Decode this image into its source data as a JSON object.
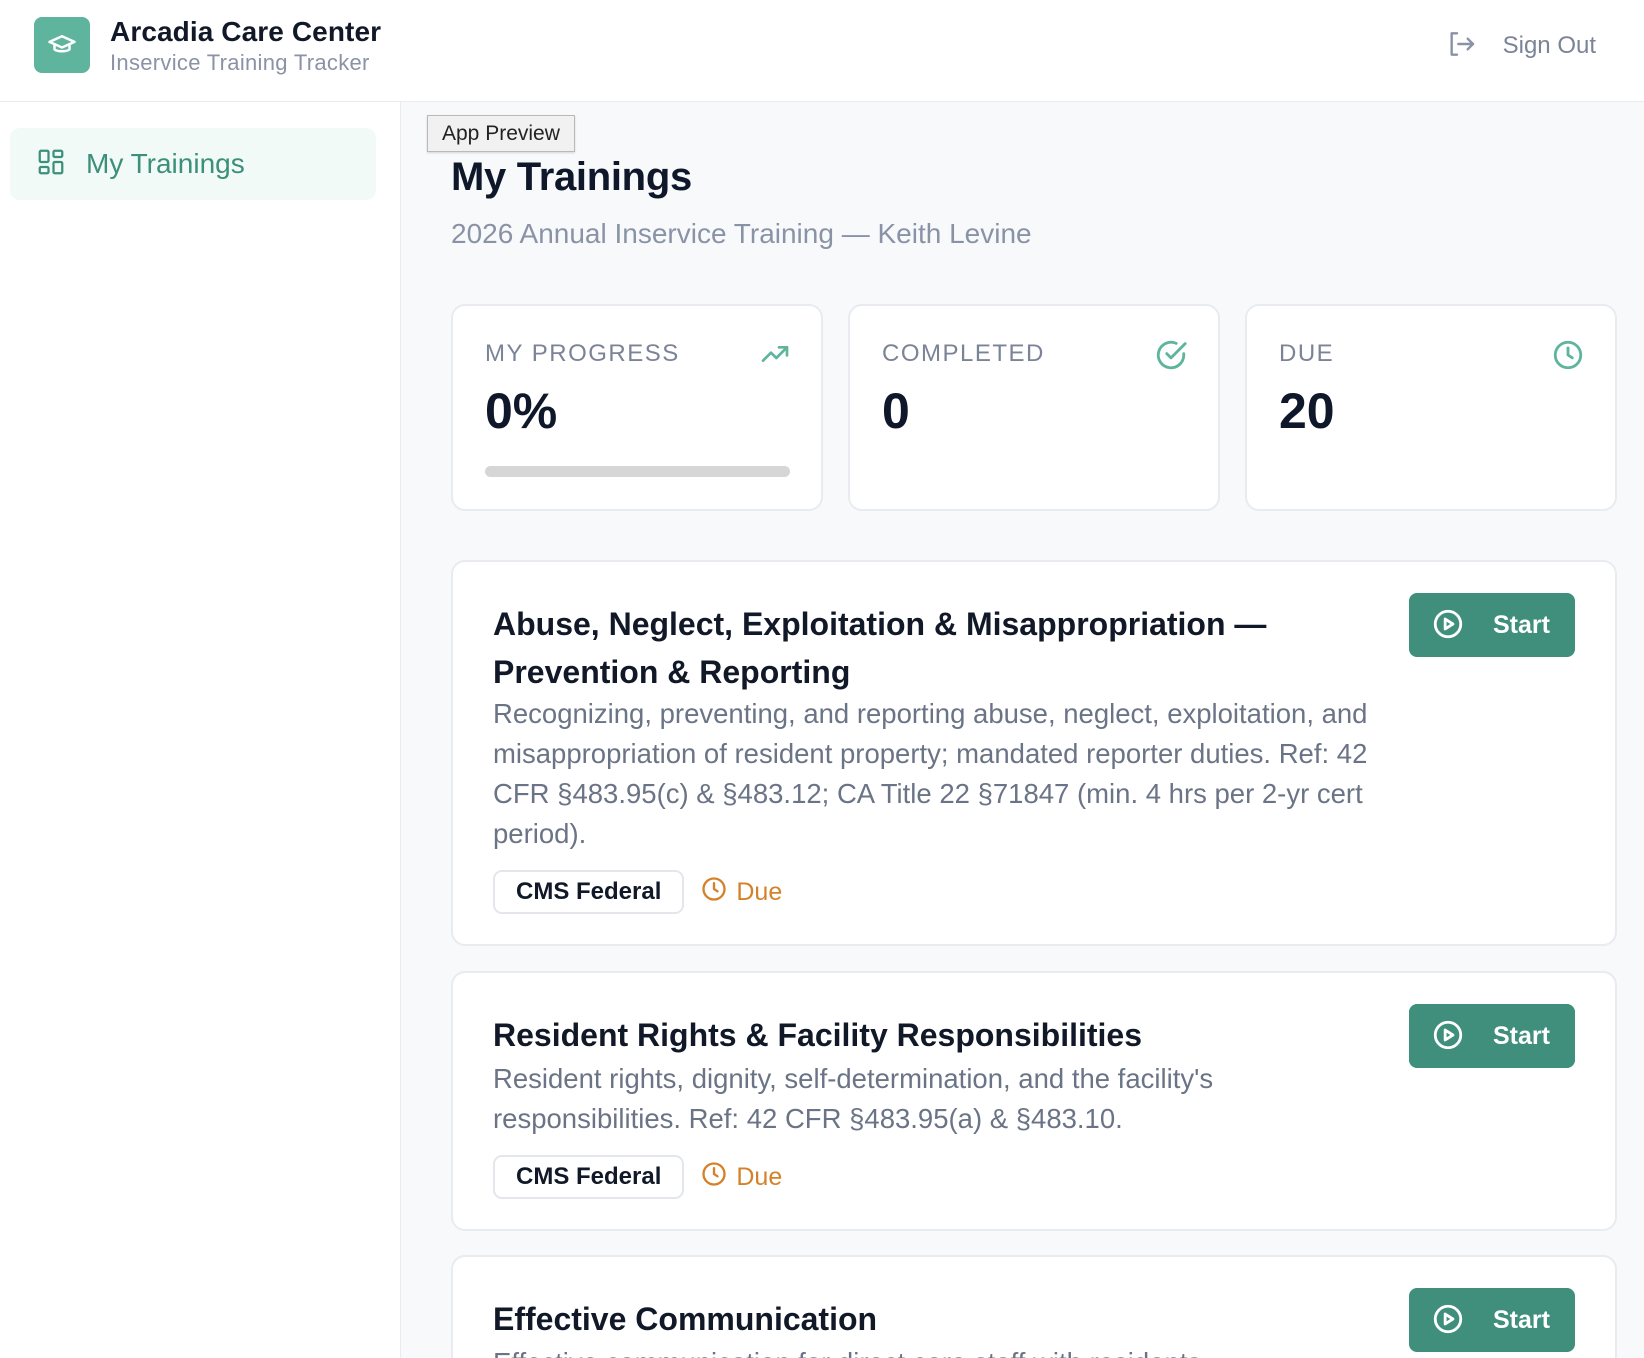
{
  "header": {
    "brand_name": "Arcadia Care Center",
    "brand_subtitle": "Inservice Training Tracker",
    "logo_icon": "graduation-cap-icon",
    "signout_label": "Sign Out"
  },
  "sidebar": {
    "items": [
      {
        "label": "My Trainings",
        "icon": "dashboard-grid-icon",
        "active": true
      }
    ]
  },
  "preview_tag": "App Preview",
  "page": {
    "title": "My Trainings",
    "subtitle": "2026 Annual Inservice Training — Keith Levine"
  },
  "stats": [
    {
      "label": "MY PROGRESS",
      "value": "0%",
      "icon": "trending-up-icon",
      "progress": 0
    },
    {
      "label": "COMPLETED",
      "value": "0",
      "icon": "check-circle-icon"
    },
    {
      "label": "DUE",
      "value": "20",
      "icon": "clock-icon"
    }
  ],
  "trainings": [
    {
      "title": "Abuse, Neglect, Exploitation & Misappropriation — Prevention & Reporting",
      "description": "Recognizing, preventing, and reporting abuse, neglect, exploitation, and misappropriation of resident property; mandated reporter duties. Ref: 42 CFR §483.95(c) & §483.12; CA Title 22 §71847 (min. 4 hrs per 2-yr cert period).",
      "tag": "CMS Federal",
      "status": "Due",
      "action": "Start"
    },
    {
      "title": "Resident Rights & Facility Responsibilities",
      "description": "Resident rights, dignity, self-determination, and the facility's responsibilities. Ref: 42 CFR §483.95(a) & §483.10.",
      "tag": "CMS Federal",
      "status": "Due",
      "action": "Start"
    },
    {
      "title": "Effective Communication",
      "description": "Effective communication for direct care staff with residents",
      "action": "Start"
    }
  ],
  "colors": {
    "accent": "#3f8f7c",
    "accent_light": "#5fb49e",
    "due": "#d4822a"
  }
}
